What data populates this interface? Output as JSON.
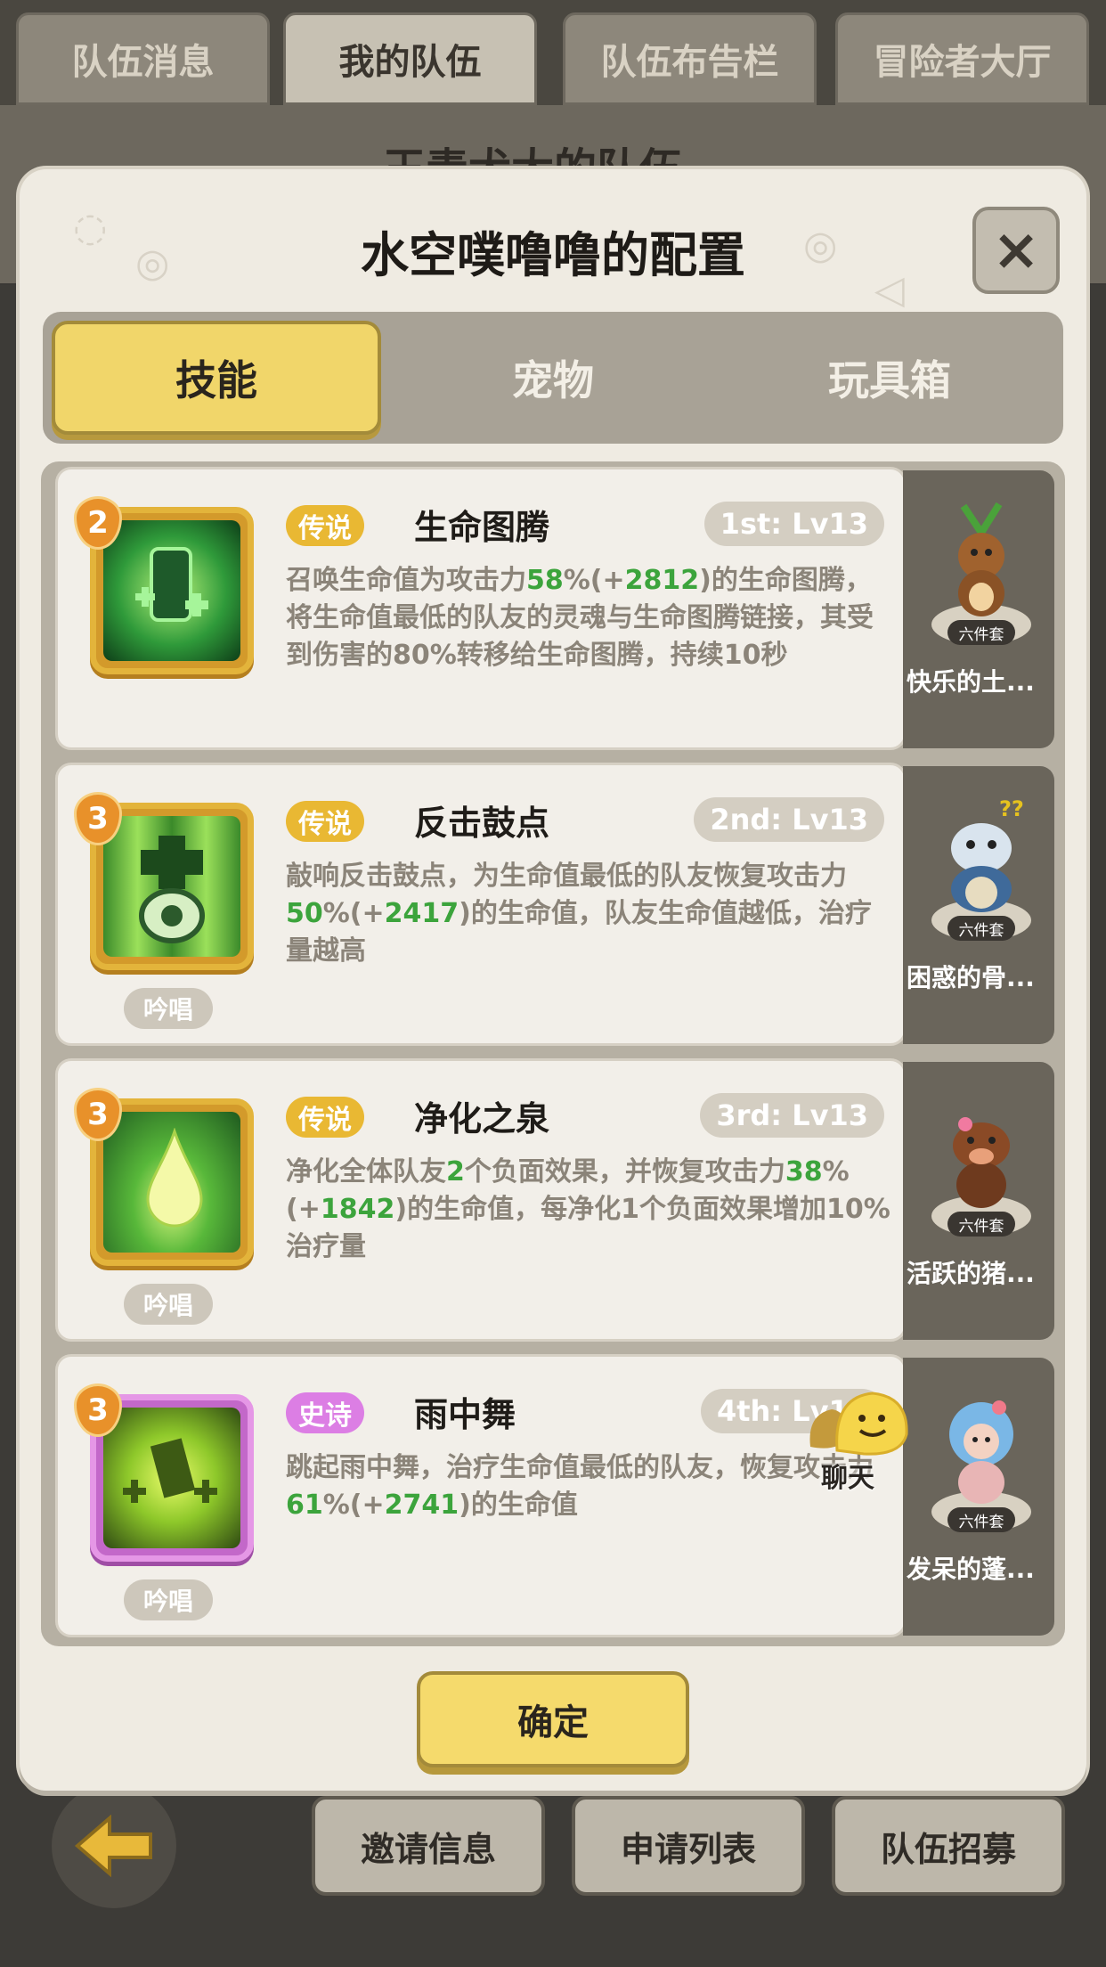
{
  "top_tabs": [
    {
      "label": "队伍消息",
      "active": false
    },
    {
      "label": "我的队伍",
      "active": true
    },
    {
      "label": "队伍布告栏",
      "active": false
    },
    {
      "label": "冒险者大厅",
      "active": false
    }
  ],
  "background": {
    "team_title": "王毒犬大的队伍"
  },
  "modal": {
    "title": "水空噗噜噜的配置",
    "close_label": "×",
    "sub_tabs": [
      {
        "label": "技能",
        "active": true
      },
      {
        "label": "宠物",
        "active": false
      },
      {
        "label": "玩具箱",
        "active": false
      }
    ],
    "confirm_label": "确定"
  },
  "skills": [
    {
      "level": "2",
      "rarity": "传说",
      "name": "生命图腾",
      "rank": "1st: Lv13",
      "desc_parts": [
        "召唤生命值为攻击力",
        "58",
        "%(+",
        "2812",
        ")的生命图腾，将生命值最低的队友的灵魂与生命图腾链接，其受到伤害的80%转移给生命图腾，持续10秒"
      ],
      "chant": ""
    },
    {
      "level": "3",
      "rarity": "传说",
      "name": "反击鼓点",
      "rank": "2nd: Lv13",
      "desc_parts": [
        "敲响反击鼓点，为生命值最低的队友恢复攻击力",
        "50",
        "%(+",
        "2417",
        ")的生命值，队友生命值越低，治疗量越高"
      ],
      "chant": "吟唱"
    },
    {
      "level": "3",
      "rarity": "传说",
      "name": "净化之泉",
      "rank": "3rd: Lv13",
      "desc_parts": [
        "净化全体队友",
        "2",
        "个负面效果，并恢复攻击力",
        "38",
        "%(+",
        "1842",
        ")的生命值，每净化1个负面效果增加10%治疗量"
      ],
      "chant": "吟唱"
    },
    {
      "level": "3",
      "rarity": "史诗",
      "name": "雨中舞",
      "rank": "4th: Lv13",
      "desc_parts": [
        "跳起雨中舞，治疗生命值最低的队友，恢复攻击力",
        "61",
        "%(+",
        "2741",
        ")的生命值"
      ],
      "chant": "吟唱"
    }
  ],
  "pets": [
    {
      "name": "快乐的土...",
      "set_tag": "六件套"
    },
    {
      "name": "困惑的骨...",
      "set_tag": "六件套"
    },
    {
      "name": "活跃的猪...",
      "set_tag": "六件套"
    },
    {
      "name": "发呆的蓬...",
      "set_tag": "六件套"
    }
  ],
  "chat": {
    "label": "聊天"
  },
  "bottom_buttons": [
    {
      "label": "邀请信息"
    },
    {
      "label": "申请列表"
    },
    {
      "label": "队伍招募"
    }
  ]
}
